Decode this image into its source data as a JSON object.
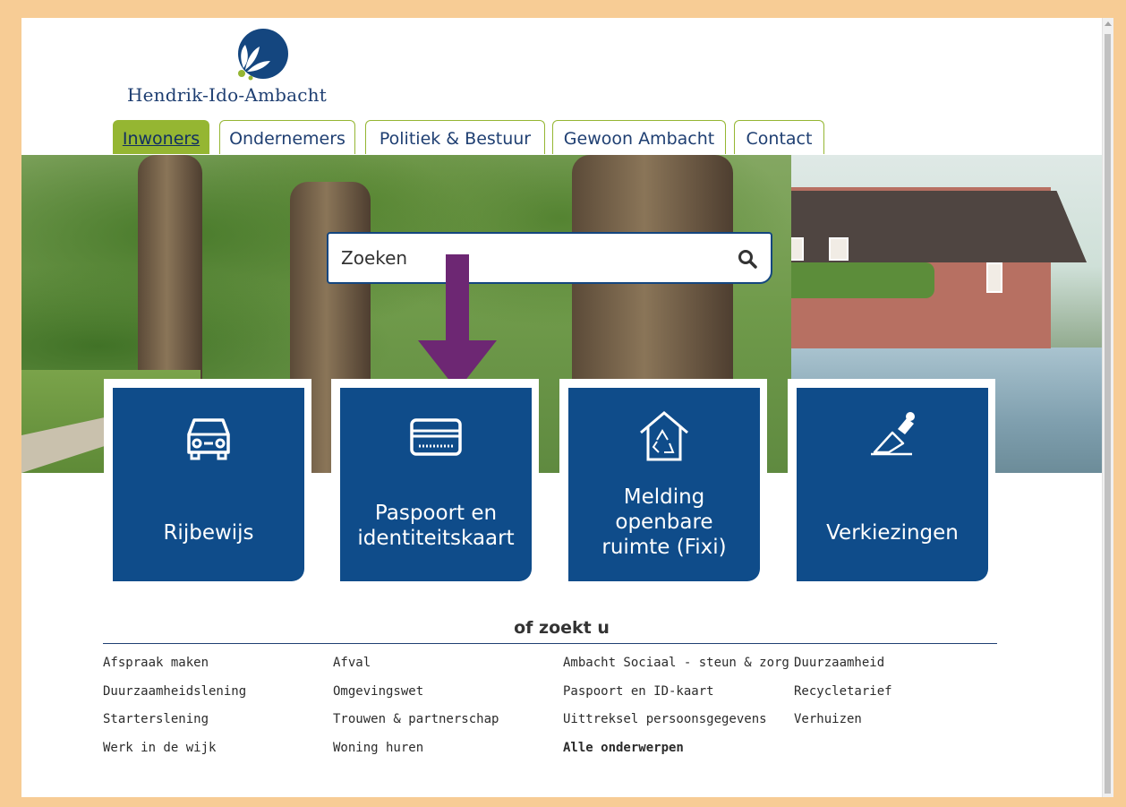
{
  "brand": {
    "name": "Hendrik-Ido-Ambacht"
  },
  "colors": {
    "frame": "#f7cc95",
    "navy": "#0f4c8a",
    "green": "#95b632",
    "arrow": "#6d2773"
  },
  "nav": {
    "tabs": [
      {
        "label": "Inwoners",
        "active": true
      },
      {
        "label": "Ondernemers",
        "active": false
      },
      {
        "label": "Politiek & Bestuur",
        "active": false
      },
      {
        "label": "Gewoon Ambacht",
        "active": false
      },
      {
        "label": "Contact",
        "active": false
      }
    ]
  },
  "search": {
    "placeholder": "Zoeken",
    "icon": "search-icon"
  },
  "tiles": [
    {
      "label": "Rijbewijs",
      "icon": "car-icon"
    },
    {
      "label": "Paspoort en identiteitskaart",
      "icon": "id-card-icon"
    },
    {
      "label": "Melding openbare ruimte (Fixi)",
      "icon": "recycle-house-icon"
    },
    {
      "label": "Verkiezingen",
      "icon": "ballot-icon"
    }
  ],
  "more": {
    "heading": "of zoekt u",
    "links": [
      [
        "Afspraak maken",
        "Afval",
        "Ambacht Sociaal - steun & zorg",
        "Duurzaamheid"
      ],
      [
        "Duurzaamheidslening",
        "Omgevingswet",
        "Paspoort en ID-kaart",
        "Recycletarief"
      ],
      [
        "Starterslening",
        "Trouwen & partnerschap",
        "Uittreksel persoonsgegevens",
        "Verhuizen"
      ],
      [
        "Werk in de wijk",
        "Woning huren",
        "Alle onderwerpen",
        ""
      ]
    ]
  }
}
